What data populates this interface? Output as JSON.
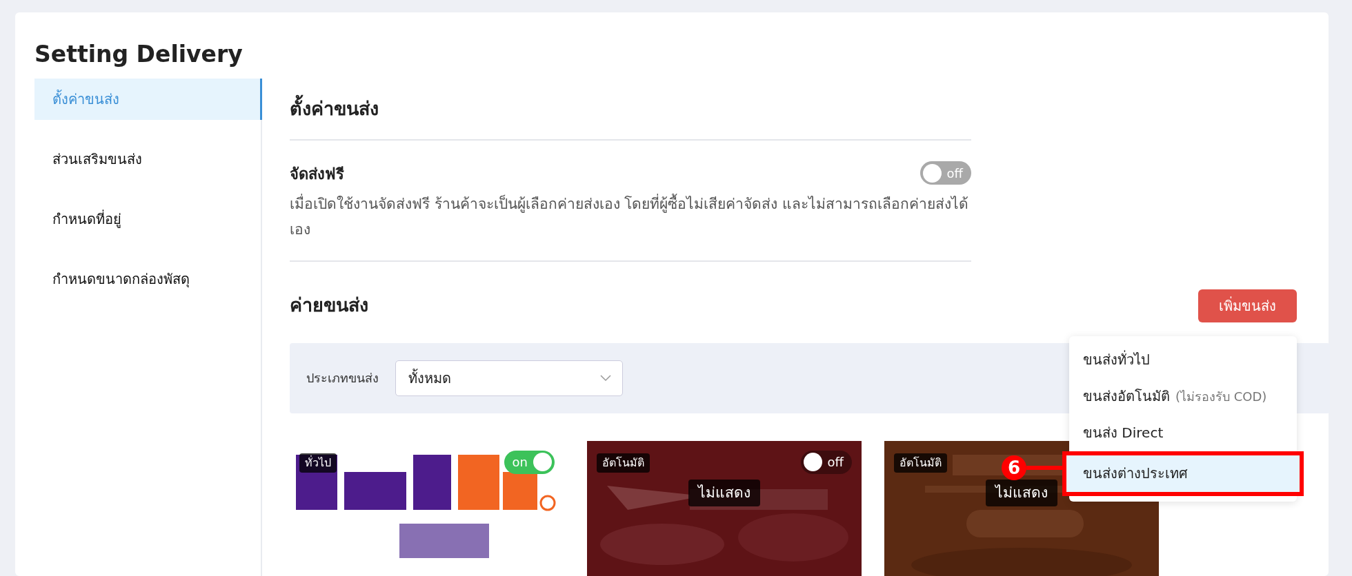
{
  "title": "Setting Delivery",
  "sidebar": {
    "items": [
      {
        "label": "ตั้งค่าขนส่ง",
        "selected": true
      },
      {
        "label": "ส่วนเสริมขนส่ง",
        "selected": false
      },
      {
        "label": "กำหนดที่อยู่",
        "selected": false
      },
      {
        "label": "กำหนดขนาดกล่องพัสดุ",
        "selected": false
      }
    ]
  },
  "section_title": "ตั้งค่าขนส่ง",
  "free_shipping": {
    "title": "จัดส่งฟรี",
    "description": "เมื่อเปิดใช้งานจัดส่งฟรี ร้านค้าจะเป็นผู้เลือกค่ายส่งเอง โดยที่ผู้ซื้อไม่เสียค่าจัดส่ง และไม่สามารถเลือกค่ายส่งได้เอง",
    "toggle": {
      "on": false,
      "label": "off"
    }
  },
  "carriers": {
    "title": "ค่ายขนส่ง",
    "add_button": "เพิ่มขนส่ง",
    "add_menu": {
      "items": [
        {
          "label": "ขนส่งทั่วไป",
          "selected": false
        },
        {
          "label": "ขนส่งอัตโนมัติ",
          "note": "(ไม่รองรับ COD)",
          "selected": false
        },
        {
          "label": "ขนส่ง Direct",
          "selected": false
        },
        {
          "label": "ขนส่งต่างประเทศ",
          "selected": true
        }
      ]
    },
    "filter": {
      "label": "ประเภทขนส่ง",
      "value": "ทั้งหมด"
    },
    "cards": [
      {
        "kind": "picture",
        "type_badge": "ทั่วไป",
        "toggle": {
          "on": true,
          "label": "on"
        }
      },
      {
        "kind": "picture",
        "type_badge": "อัตโนมัติ",
        "toggle": {
          "on": false,
          "label": "off"
        },
        "status": "ไม่แสดง"
      },
      {
        "kind": "picture",
        "type_badge": "อัตโนมัติ",
        "status": "ไม่แสดง"
      }
    ]
  },
  "annotation": {
    "step": "6"
  }
}
